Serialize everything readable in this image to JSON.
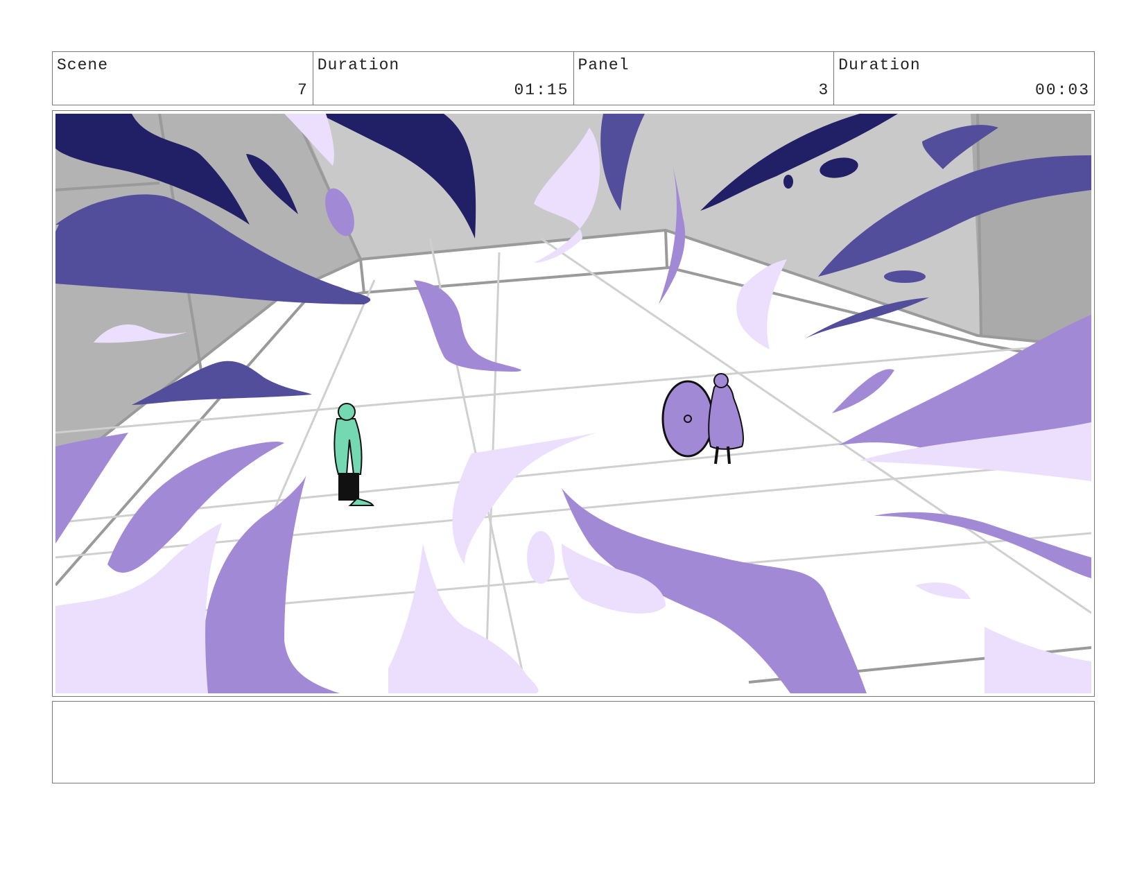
{
  "header": {
    "scene_label": "Scene",
    "scene_value": "7",
    "scene_duration_label": "Duration",
    "scene_duration_value": "01:15",
    "panel_label": "Panel",
    "panel_value": "3",
    "panel_duration_label": "Duration",
    "panel_duration_value": "00:03"
  },
  "notes": {
    "text": ""
  },
  "palette": {
    "dark_indigo": "#211f66",
    "indigo": "#534e9b",
    "violet": "#a289d6",
    "lavender": "#ecdefd",
    "wall_gray": "#c9c9c9",
    "floor_white": "#ffffff",
    "character_teal": "#74d9b2"
  }
}
